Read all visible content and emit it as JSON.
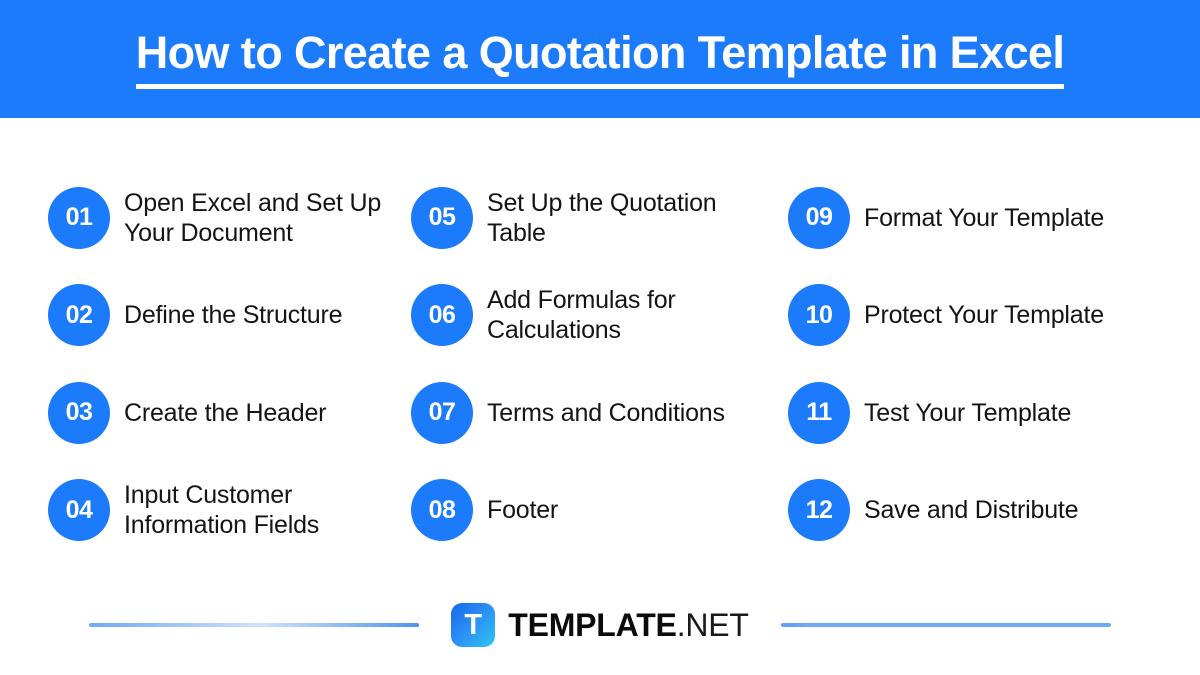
{
  "header": {
    "title": "How to Create a Quotation Template in Excel",
    "background_color": "#1b7bfa",
    "text_color": "#ffffff"
  },
  "theme": {
    "accent_color": "#1b7bfa",
    "page_background": "#ffffff",
    "text_color": "#141414",
    "rule_color": "#6cabf6"
  },
  "steps": {
    "columns": [
      {
        "items": [
          {
            "number": "01",
            "label": "Open Excel and Set Up Your Document"
          },
          {
            "number": "02",
            "label": "Define the Structure"
          },
          {
            "number": "03",
            "label": "Create the Header"
          },
          {
            "number": "04",
            "label": "Input Customer Information Fields"
          }
        ]
      },
      {
        "items": [
          {
            "number": "05",
            "label": "Set Up the Quotation Table"
          },
          {
            "number": "06",
            "label": "Add Formulas for Calculations"
          },
          {
            "number": "07",
            "label": "Terms and Conditions"
          },
          {
            "number": "08",
            "label": "Footer"
          }
        ]
      },
      {
        "items": [
          {
            "number": "09",
            "label": "Format Your Template"
          },
          {
            "number": "10",
            "label": "Protect Your Template"
          },
          {
            "number": "11",
            "label": "Test Your Template"
          },
          {
            "number": "12",
            "label": "Save and Distribute"
          }
        ]
      }
    ]
  },
  "footer": {
    "logo_mark_letter": "T",
    "brand_primary": "TEMPLATE",
    "brand_secondary": ".NET"
  }
}
